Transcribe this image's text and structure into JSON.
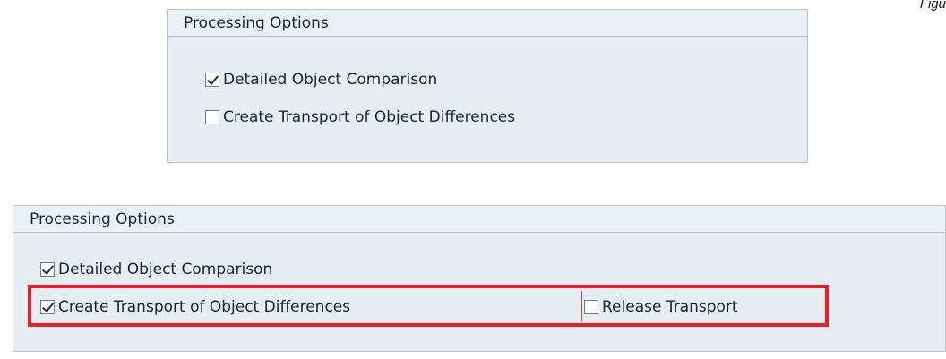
{
  "figure_label": "Figu",
  "panel_top": {
    "header": "Processing Options",
    "options": [
      {
        "label": "Detailed Object Comparison",
        "checked": true
      },
      {
        "label": "Create Transport of Object Differences",
        "checked": false
      }
    ]
  },
  "panel_bottom": {
    "header": "Processing Options",
    "options": [
      {
        "label": "Detailed Object Comparison",
        "checked": true
      },
      {
        "label": "Create Transport of Object Differences",
        "checked": true
      },
      {
        "label": "Release Transport",
        "checked": false
      }
    ],
    "highlight_color": "#ea1e26"
  }
}
